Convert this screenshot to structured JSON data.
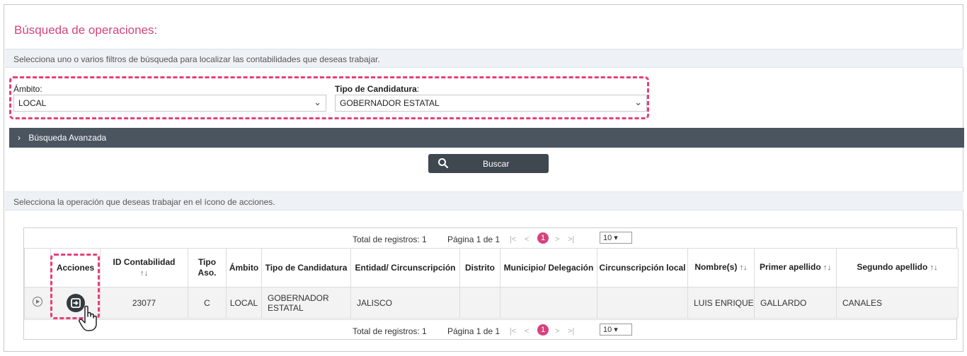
{
  "page": {
    "title": "Búsqueda de operaciones:"
  },
  "info": {
    "filters_hint": "Selecciona uno o varios filtros de búsqueda para localizar las contabilidades que deseas trabajar.",
    "operation_hint": "Selecciona la operación que deseas trabajar en el ícono de acciones."
  },
  "filters": {
    "ambito": {
      "label": "Ámbito",
      "value": "LOCAL"
    },
    "tipo_candidatura": {
      "label": "Tipo de Candidatura",
      "value": "GOBERNADOR ESTATAL"
    }
  },
  "advanced_search": {
    "label": "Búsqueda Avanzada"
  },
  "search_button": {
    "label": "Buscar"
  },
  "pager": {
    "total": "Total de registros: 1",
    "page": "Página 1 de 1",
    "current": "1",
    "per_page": "10"
  },
  "table": {
    "headers": {
      "acciones": "Acciones",
      "id": "ID Contabilidad",
      "tipo_aso": "Tipo Aso.",
      "ambito": "Ámbito",
      "tipo_candidatura": "Tipo de Candidatura",
      "entidad": "Entidad/ Circunscripción",
      "distrito": "Distrito",
      "municipio": "Municipio/ Delegación",
      "circ_local": "Circunscripción local",
      "nombre": "Nombre(s)",
      "primer_apellido": "Primer apellido",
      "segundo_apellido": "Segundo apellido"
    },
    "rows": [
      {
        "id": "23077",
        "tipo_aso": "C",
        "ambito": "LOCAL",
        "tipo_candidatura": "GOBERNADOR ESTATAL",
        "entidad": "JALISCO",
        "distrito": "",
        "municipio": "",
        "circ_local": "",
        "nombre": "LUIS ENRIQUE",
        "primer_apellido": "GALLARDO",
        "segundo_apellido": "CANALES"
      }
    ]
  },
  "colors": {
    "accent": "#d5437d",
    "highlight": "#e83e7a",
    "dark_bar": "#4a5560"
  }
}
